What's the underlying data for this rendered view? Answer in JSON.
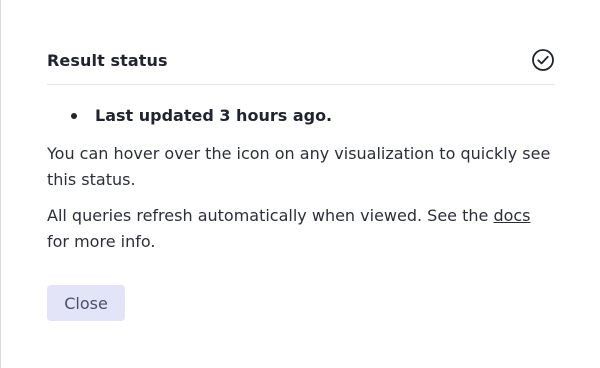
{
  "dialog": {
    "title": "Result status",
    "status_icon": "check-circle-icon",
    "status_items": [
      "Last updated 3 hours ago."
    ],
    "paragraph_1": "You can hover over the icon on any visualization to quickly see this status.",
    "paragraph_2_before": "All queries refresh automatically when viewed. See the ",
    "paragraph_2_link": "docs",
    "paragraph_2_after": " for more info.",
    "close_label": "Close"
  },
  "colors": {
    "button_bg": "#e3e4f7",
    "button_text": "#4a4f6b",
    "text": "#1f2430",
    "divider": "#e4e4e8"
  }
}
